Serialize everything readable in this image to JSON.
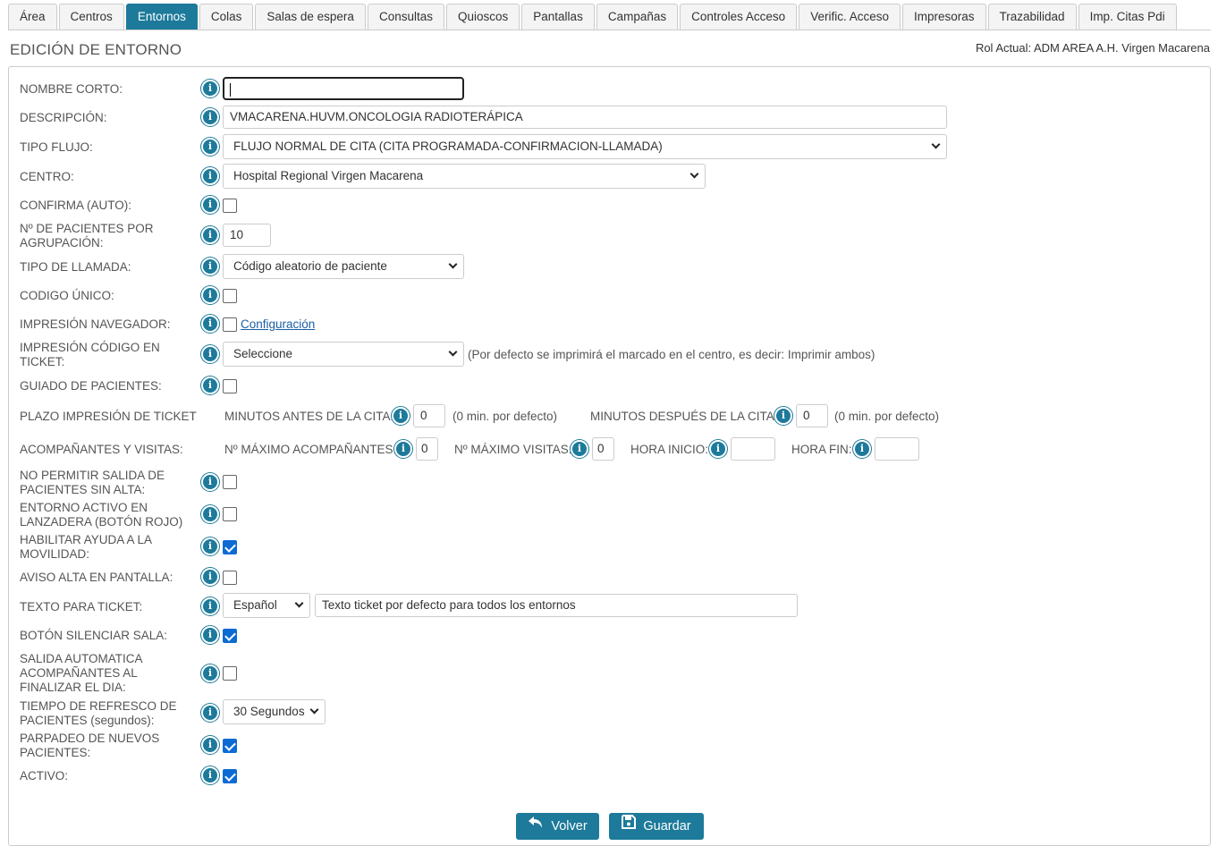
{
  "tabs": [
    "Área",
    "Centros",
    "Entornos",
    "Colas",
    "Salas de espera",
    "Consultas",
    "Quioscos",
    "Pantallas",
    "Campañas",
    "Controles Acceso",
    "Verific. Acceso",
    "Impresoras",
    "Trazabilidad",
    "Imp. Citas Pdi"
  ],
  "active_tab": "Entornos",
  "page_title": "EDICIÓN DE ENTORNO",
  "role": "Rol Actual: ADM AREA A.H. Virgen Macarena",
  "labels": {
    "nombre_corto": "NOMBRE CORTO:",
    "descripcion": "DESCRIPCIÓN:",
    "tipo_flujo": "TIPO FLUJO:",
    "centro": "CENTRO:",
    "confirma": "CONFIRMA (AUTO):",
    "pacientes_agrup_1": "Nº DE PACIENTES POR",
    "pacientes_agrup_2": "AGRUPACIÓN:",
    "tipo_llamada": "TIPO DE LLAMADA:",
    "codigo_unico": "CODIGO ÚNICO:",
    "impresion_navegador": "IMPRESIÓN NAVEGADOR:",
    "impresion_codigo_1": "IMPRESIÓN CÓDIGO EN",
    "impresion_codigo_2": "TICKET:",
    "guiado": "GUIADO DE PACIENTES:",
    "plazo": "PLAZO IMPRESIÓN DE TICKET",
    "min_antes": "MINUTOS ANTES DE LA CITA:",
    "min_despues": "MINUTOS DESPUÉS DE LA CITA:",
    "por_defecto": "(0 min. por defecto)",
    "acompanantes": "ACOMPAÑANTES Y VISITAS:",
    "max_acomp": "Nº MÁXIMO ACOMPAÑANTES:",
    "max_visitas": "Nº MÁXIMO VISITAS:",
    "hora_inicio": "HORA INICIO:",
    "hora_fin": "HORA FIN:",
    "no_salida_1": "NO PERMITIR SALIDA DE",
    "no_salida_2": "PACIENTES SIN ALTA:",
    "lanzadera_1": "ENTORNO ACTIVO EN",
    "lanzadera_2": "LANZADERA (BOTÓN ROJO)",
    "movilidad_1": "HABILITAR AYUDA A LA",
    "movilidad_2": "MOVILIDAD:",
    "aviso_alta": "AVISO ALTA EN PANTALLA:",
    "texto_ticket": "TEXTO PARA TICKET:",
    "silenciar": "BOTÓN SILENCIAR SALA:",
    "salida_auto_1": "SALIDA AUTOMATICA",
    "salida_auto_2": "ACOMPAÑANTES AL",
    "salida_auto_3": "FINALIZAR EL DIA:",
    "refresco_1": "TIEMPO DE REFRESCO DE",
    "refresco_2": "PACIENTES (segundos):",
    "parpadeo_1": "PARPADEO DE NUEVOS",
    "parpadeo_2": "PACIENTES:",
    "activo": "ACTIVO:"
  },
  "values": {
    "nombre_corto": "",
    "descripcion": "VMACARENA.HUVM.ONCOLOGIA RADIOTERÁPICA",
    "tipo_flujo": "FLUJO NORMAL DE CITA (CITA PROGRAMADA-CONFIRMACION-LLAMADA)",
    "centro": "Hospital Regional Virgen Macarena",
    "pacientes_agrup": "10",
    "tipo_llamada": "Código aleatorio de paciente",
    "impresion_codigo": "Seleccione",
    "impresion_codigo_note": "(Por defecto se imprimirá el marcado en el centro, es decir: Imprimir ambos)",
    "configuracion_link": "Configuración",
    "min_antes": "0",
    "min_despues": "0",
    "max_acomp": "0",
    "max_visitas": "0",
    "hora_inicio": "",
    "hora_fin": "",
    "idioma": "Español",
    "texto_ticket": "Texto ticket por defecto para todos los entornos",
    "refresco": "30 Segundos"
  },
  "checkboxes": {
    "confirma": false,
    "codigo_unico": false,
    "impresion_navegador": false,
    "guiado": false,
    "no_salida": false,
    "lanzadera": false,
    "movilidad": true,
    "aviso_alta": false,
    "silenciar": true,
    "salida_auto": false,
    "parpadeo": true,
    "activo": true
  },
  "buttons": {
    "volver": "Volver",
    "guardar": "Guardar"
  },
  "icons": {
    "info": "info-icon",
    "volver": "undo-arrow-icon",
    "guardar": "save-floppy-icon"
  },
  "colors": {
    "accent": "#1d7a9a",
    "checkbox": "#0b6bd3"
  }
}
